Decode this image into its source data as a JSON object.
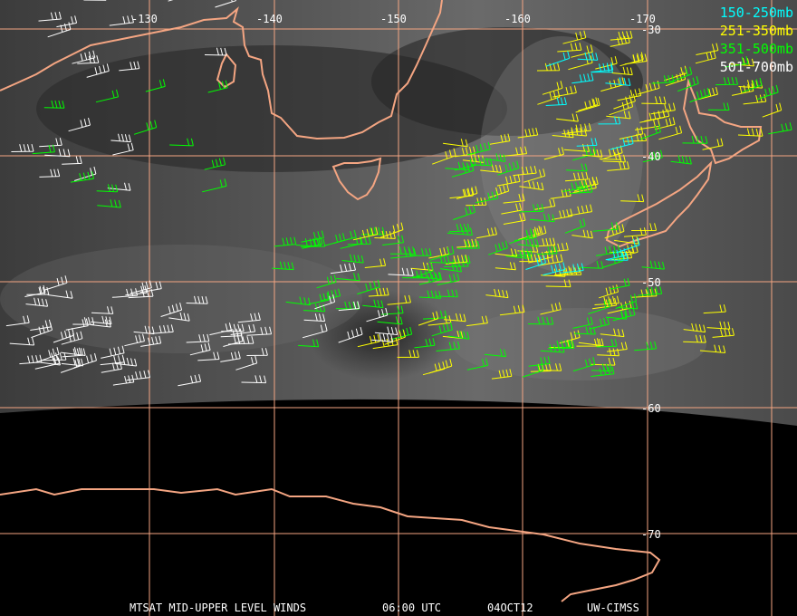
{
  "map": {
    "longitude_labels": [
      "-130",
      "-140",
      "-150",
      "-160",
      "-170"
    ],
    "latitude_labels": [
      "-30",
      "-40",
      "-50",
      "-60",
      "-70"
    ]
  },
  "legend": [
    {
      "label": "150-250mb",
      "color": "#00ffff"
    },
    {
      "label": "251-350mb",
      "color": "#ffff00"
    },
    {
      "label": "351-500mb",
      "color": "#00ff00"
    },
    {
      "label": "501-700mb",
      "color": "#ffffff"
    }
  ],
  "footer": {
    "product": "MTSAT MID-UPPER LEVEL WINDS",
    "time": "06:00 UTC",
    "date": "04OCT12",
    "credit": "UW-CIMSS"
  },
  "colors": {
    "grid": "#f4a582",
    "coastline": "#f4a582",
    "background": "#000000",
    "imagery_dark": "#2a2a2a",
    "imagery_light": "#9a9a9a"
  }
}
